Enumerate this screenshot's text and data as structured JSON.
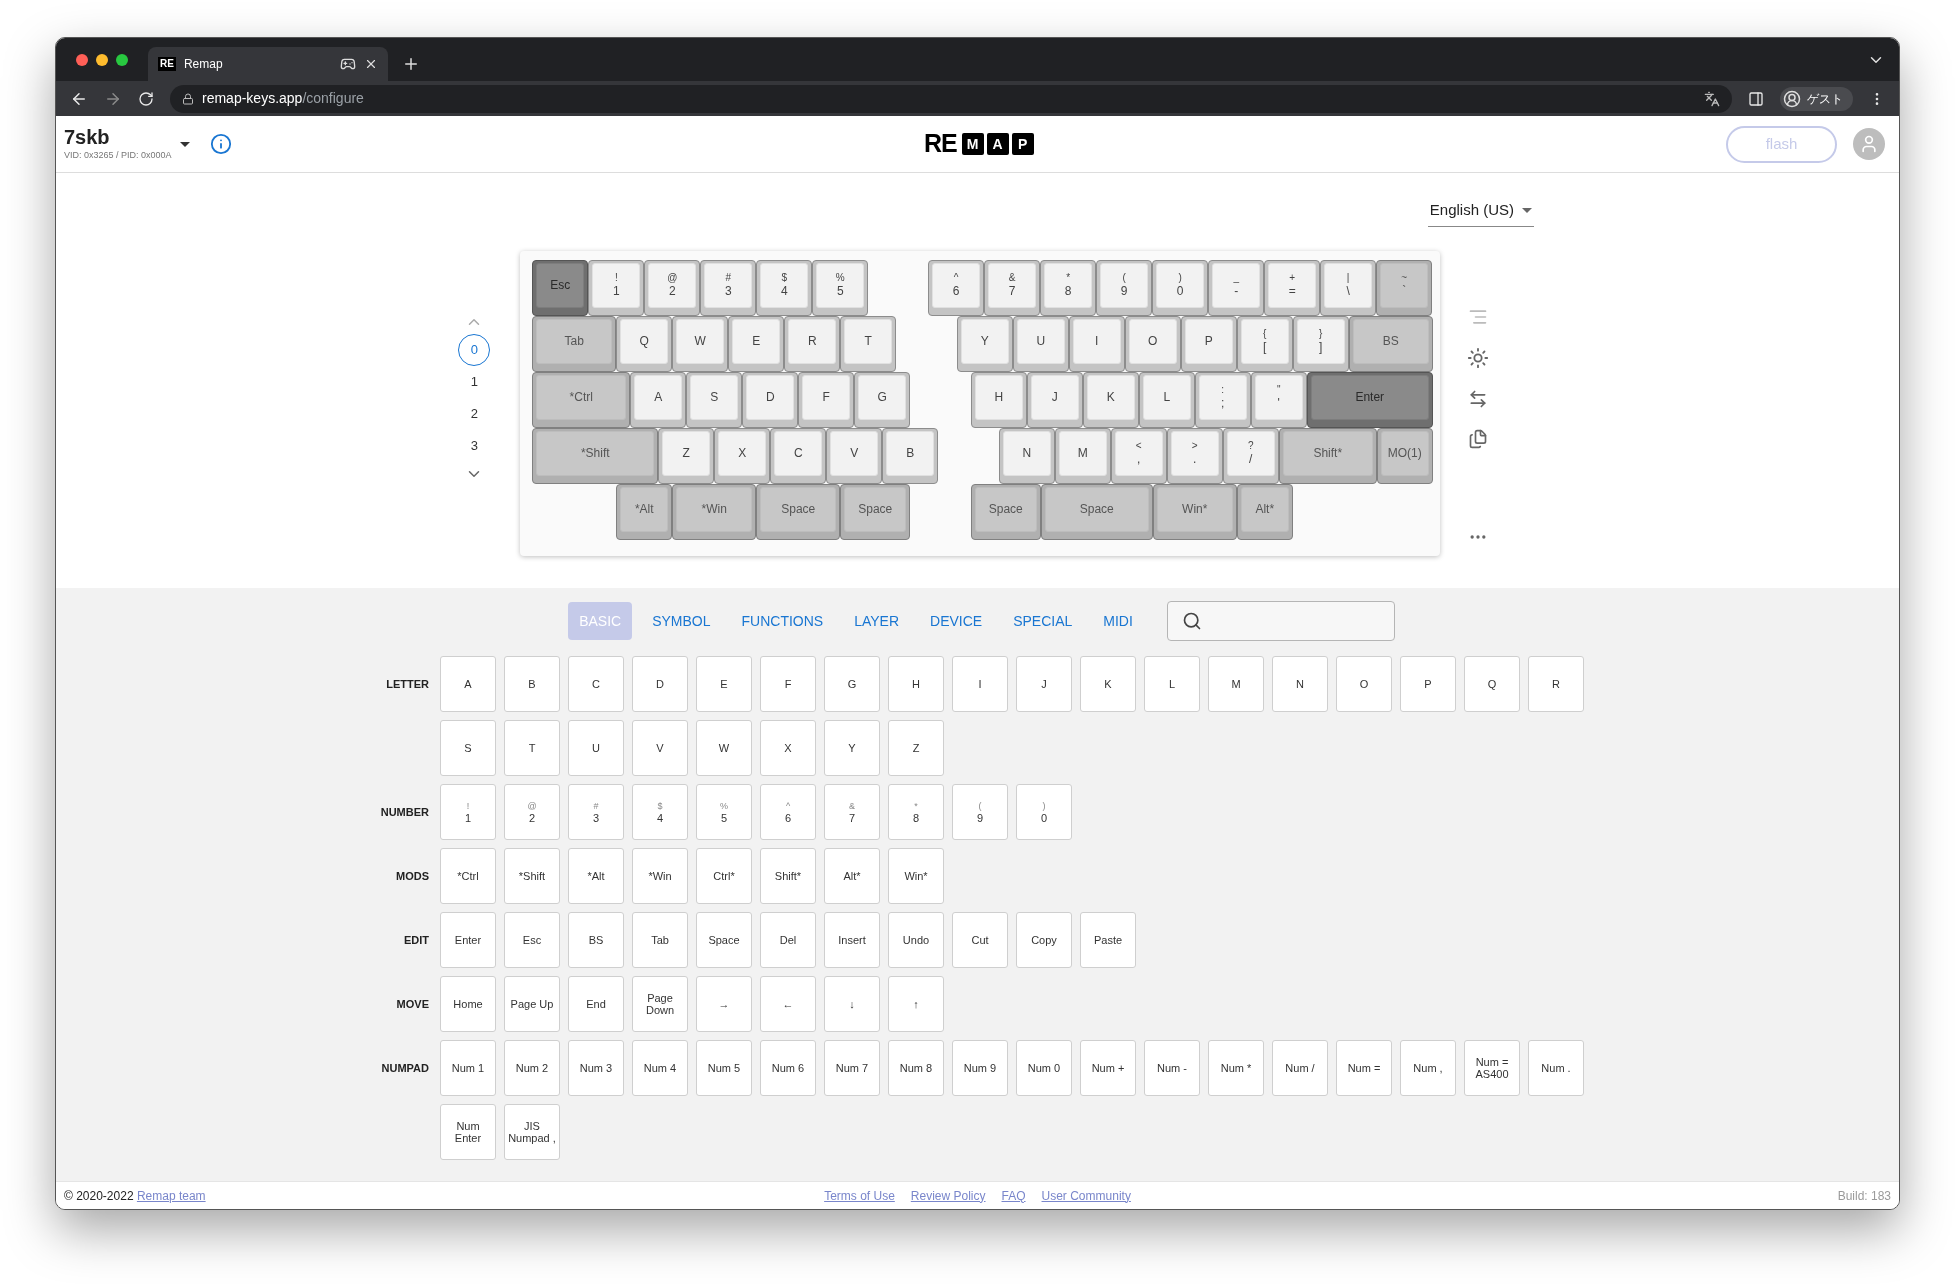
{
  "browser": {
    "tab": {
      "favicon": "RE",
      "title": "Remap"
    },
    "address": {
      "host": "remap-keys.app",
      "path": "/configure"
    },
    "profile": "ゲスト"
  },
  "header": {
    "device": "7skb",
    "ids": "VID: 0x3265 / PID: 0x000A",
    "logo": {
      "plain": "RE",
      "boxed": [
        "M",
        "A",
        "P"
      ]
    },
    "flash_button": {
      "label": "flash",
      "disabled": true
    }
  },
  "language": "English (US)",
  "layers": [
    {
      "label": "0",
      "selected": true
    },
    {
      "label": "1",
      "selected": false
    },
    {
      "label": "2",
      "selected": false
    },
    {
      "label": "3",
      "selected": false
    }
  ],
  "keyboard": {
    "keys": [
      {
        "label": "Esc",
        "kind": "active"
      },
      {
        "top": "!",
        "label": "1",
        "kind": "letter"
      },
      {
        "top": "@",
        "label": "2",
        "kind": "letter"
      },
      {
        "top": "#",
        "label": "3",
        "kind": "letter"
      },
      {
        "top": "$",
        "label": "4",
        "kind": "letter"
      },
      {
        "top": "%",
        "label": "5",
        "kind": "letter"
      },
      {
        "top": "^",
        "label": "6",
        "kind": "letter"
      },
      {
        "top": "&",
        "label": "7",
        "kind": "letter"
      },
      {
        "top": "*",
        "label": "8",
        "kind": "letter"
      },
      {
        "top": "(",
        "label": "9",
        "kind": "letter"
      },
      {
        "top": ")",
        "label": "0",
        "kind": "letter"
      },
      {
        "top": "_",
        "label": "-",
        "kind": "letter"
      },
      {
        "top": "+",
        "label": "=",
        "kind": "letter"
      },
      {
        "top": "|",
        "label": "\\",
        "kind": "letter"
      },
      {
        "top": "~",
        "label": "`",
        "kind": "modifier"
      },
      {
        "label": "Tab",
        "kind": "modifier"
      },
      {
        "label": "Q",
        "kind": "letter"
      },
      {
        "label": "W",
        "kind": "letter"
      },
      {
        "label": "E",
        "kind": "letter"
      },
      {
        "label": "R",
        "kind": "letter"
      },
      {
        "label": "T",
        "kind": "letter"
      },
      {
        "label": "Y",
        "kind": "letter"
      },
      {
        "label": "U",
        "kind": "letter"
      },
      {
        "label": "I",
        "kind": "letter"
      },
      {
        "label": "O",
        "kind": "letter"
      },
      {
        "label": "P",
        "kind": "letter"
      },
      {
        "top": "{",
        "label": "[",
        "kind": "letter"
      },
      {
        "top": "}",
        "label": "]",
        "kind": "letter"
      },
      {
        "label": "BS",
        "kind": "modifier"
      },
      {
        "label": "*Ctrl",
        "kind": "modifier"
      },
      {
        "label": "A",
        "kind": "letter"
      },
      {
        "label": "S",
        "kind": "letter"
      },
      {
        "label": "D",
        "kind": "letter"
      },
      {
        "label": "F",
        "kind": "letter"
      },
      {
        "label": "G",
        "kind": "letter"
      },
      {
        "label": "H",
        "kind": "letter"
      },
      {
        "label": "J",
        "kind": "letter"
      },
      {
        "label": "K",
        "kind": "letter"
      },
      {
        "label": "L",
        "kind": "letter"
      },
      {
        "top": ":",
        "label": ";",
        "kind": "letter"
      },
      {
        "top": "\"",
        "label": "'",
        "kind": "letter"
      },
      {
        "label": "Enter",
        "kind": "active"
      },
      {
        "label": "*Shift",
        "kind": "modifier"
      },
      {
        "label": "Z",
        "kind": "letter"
      },
      {
        "label": "X",
        "kind": "letter"
      },
      {
        "label": "C",
        "kind": "letter"
      },
      {
        "label": "V",
        "kind": "letter"
      },
      {
        "label": "B",
        "kind": "letter"
      },
      {
        "label": "N",
        "kind": "letter"
      },
      {
        "label": "M",
        "kind": "letter"
      },
      {
        "top": "<",
        "label": ",",
        "kind": "letter"
      },
      {
        "top": ">",
        "label": ".",
        "kind": "letter"
      },
      {
        "top": "?",
        "label": "/",
        "kind": "letter"
      },
      {
        "label": "Shift*",
        "kind": "modifier"
      },
      {
        "label": "MO(1)",
        "kind": "modifier"
      },
      {
        "label": "*Alt",
        "kind": "modifier"
      },
      {
        "label": "*Win",
        "kind": "modifier"
      },
      {
        "label": "Space",
        "kind": "modifier"
      },
      {
        "label": "Space",
        "kind": "modifier"
      },
      {
        "label": "Space",
        "kind": "modifier"
      },
      {
        "label": "Space",
        "kind": "modifier"
      },
      {
        "label": "Win*",
        "kind": "modifier"
      },
      {
        "label": "Alt*",
        "kind": "modifier"
      }
    ]
  },
  "palette": {
    "tabs": [
      {
        "label": "BASIC",
        "selected": true
      },
      {
        "label": "SYMBOL",
        "selected": false
      },
      {
        "label": "FUNCTIONS",
        "selected": false
      },
      {
        "label": "LAYER",
        "selected": false
      },
      {
        "label": "DEVICE",
        "selected": false
      },
      {
        "label": "SPECIAL",
        "selected": false
      },
      {
        "label": "MIDI",
        "selected": false
      }
    ],
    "groups": [
      {
        "name": "LETTER",
        "keys": [
          {
            "label": "A"
          },
          {
            "label": "B"
          },
          {
            "label": "C"
          },
          {
            "label": "D"
          },
          {
            "label": "E"
          },
          {
            "label": "F"
          },
          {
            "label": "G"
          },
          {
            "label": "H"
          },
          {
            "label": "I"
          },
          {
            "label": "J"
          },
          {
            "label": "K"
          },
          {
            "label": "L"
          },
          {
            "label": "M"
          },
          {
            "label": "N"
          },
          {
            "label": "O"
          },
          {
            "label": "P"
          },
          {
            "label": "Q"
          },
          {
            "label": "R"
          },
          {
            "label": "S"
          },
          {
            "label": "T"
          },
          {
            "label": "U"
          },
          {
            "label": "V"
          },
          {
            "label": "W"
          },
          {
            "label": "X"
          },
          {
            "label": "Y"
          },
          {
            "label": "Z"
          }
        ]
      },
      {
        "name": "NUMBER",
        "keys": [
          {
            "top": "!",
            "label": "1"
          },
          {
            "top": "@",
            "label": "2"
          },
          {
            "top": "#",
            "label": "3"
          },
          {
            "top": "$",
            "label": "4"
          },
          {
            "top": "%",
            "label": "5"
          },
          {
            "top": "^",
            "label": "6"
          },
          {
            "top": "&",
            "label": "7"
          },
          {
            "top": "*",
            "label": "8"
          },
          {
            "top": "(",
            "label": "9"
          },
          {
            "top": ")",
            "label": "0"
          }
        ]
      },
      {
        "name": "MODS",
        "keys": [
          {
            "label": "*Ctrl"
          },
          {
            "label": "*Shift"
          },
          {
            "label": "*Alt"
          },
          {
            "label": "*Win"
          },
          {
            "label": "Ctrl*"
          },
          {
            "label": "Shift*"
          },
          {
            "label": "Alt*"
          },
          {
            "label": "Win*"
          }
        ]
      },
      {
        "name": "EDIT",
        "keys": [
          {
            "label": "Enter"
          },
          {
            "label": "Esc"
          },
          {
            "label": "BS"
          },
          {
            "label": "Tab"
          },
          {
            "label": "Space"
          },
          {
            "label": "Del"
          },
          {
            "label": "Insert"
          },
          {
            "label": "Undo"
          },
          {
            "label": "Cut"
          },
          {
            "label": "Copy"
          },
          {
            "label": "Paste"
          }
        ]
      },
      {
        "name": "MOVE",
        "keys": [
          {
            "label": "Home"
          },
          {
            "label": "Page Up"
          },
          {
            "label": "End"
          },
          {
            "label": "Page Down"
          },
          {
            "label": "→"
          },
          {
            "label": "←"
          },
          {
            "label": "↓"
          },
          {
            "label": "↑"
          }
        ]
      },
      {
        "name": "NUMPAD",
        "keys": [
          {
            "label": "Num 1"
          },
          {
            "label": "Num 2"
          },
          {
            "label": "Num 3"
          },
          {
            "label": "Num 4"
          },
          {
            "label": "Num 5"
          },
          {
            "label": "Num 6"
          },
          {
            "label": "Num 7"
          },
          {
            "label": "Num 8"
          },
          {
            "label": "Num 9"
          },
          {
            "label": "Num 0"
          },
          {
            "label": "Num +"
          },
          {
            "label": "Num -"
          },
          {
            "label": "Num *"
          },
          {
            "label": "Num /"
          },
          {
            "label": "Num ="
          },
          {
            "label": "Num ,"
          },
          {
            "label": "Num = AS400"
          },
          {
            "label": "Num ."
          },
          {
            "label": "Num Enter"
          },
          {
            "label": "JIS Numpad ,"
          }
        ]
      }
    ]
  },
  "footer": {
    "copyright": "© 2020-2022",
    "team_link": "Remap team",
    "links": [
      "Terms of Use",
      "Review Policy",
      "FAQ",
      "User Community"
    ],
    "build": "Build: 183"
  }
}
